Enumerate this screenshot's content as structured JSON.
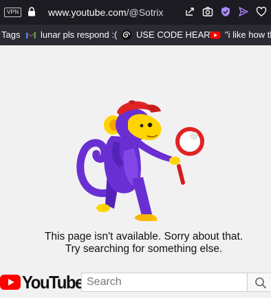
{
  "browser": {
    "vpn_label": "VPN",
    "url_host": "www.youtube.com",
    "url_path": "/@Sotrix",
    "toolbar_icons": [
      "share-icon",
      "camera-icon",
      "shield-icon",
      "send-icon",
      "heart-icon"
    ]
  },
  "bookmarks": [
    {
      "label": "Tags",
      "icon": "none"
    },
    {
      "label": "lunar pls respond :(",
      "icon": "gmail-icon"
    },
    {
      "label": "USE CODE HEART",
      "icon": "spiral-icon"
    },
    {
      "label": "\"i like how th",
      "icon": "youtube-icon"
    }
  ],
  "error_page": {
    "line1": "This page isn't available. Sorry about that.",
    "line2": "Try searching for something else."
  },
  "footer": {
    "logo_text": "YouTube",
    "search_placeholder": "Search"
  },
  "colors": {
    "brand_red": "#ff0000",
    "monkey_purple": "#6a2fd2",
    "monkey_face": "#ffd400",
    "cap_red": "#e02424"
  }
}
